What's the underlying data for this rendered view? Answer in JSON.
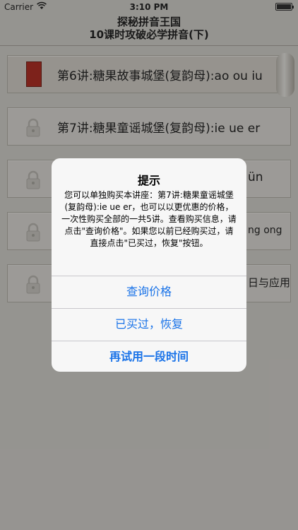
{
  "status": {
    "carrier": "Carrier",
    "time": "3:10 PM"
  },
  "nav": {
    "title_line1": "探秘拼音王国",
    "title_line2": "10课时攻破必学拼音(下)"
  },
  "lessons": [
    {
      "label": "第6讲:糖果故事城堡(复韵母):ao ou iu",
      "state": "unlocked"
    },
    {
      "label": "第7讲:糖果童谣城堡(复韵母):ie ue er",
      "state": "locked"
    },
    {
      "label": "ün",
      "state": "locked"
    },
    {
      "label": "ng ong",
      "state": "locked"
    },
    {
      "label": "日与应用",
      "state": "locked"
    }
  ],
  "alert": {
    "title": "提示",
    "message": "您可以单独购买本讲座：第7讲:糖果童谣城堡(复韵母):ie ue er，也可以以更优惠的价格，一次性购买全部的一共5讲。查看购买信息，请点击\"查询价格\"。如果您以前已经购买过，请直接点击\"已买过，恢复\"按钮。",
    "buttons": {
      "query_price": "查询价格",
      "restore": "已买过，恢复",
      "trial": "再试用一段时间"
    }
  },
  "colors": {
    "background": "#d9d7d1",
    "accent": "#1a73e8",
    "door": "#b22014"
  }
}
